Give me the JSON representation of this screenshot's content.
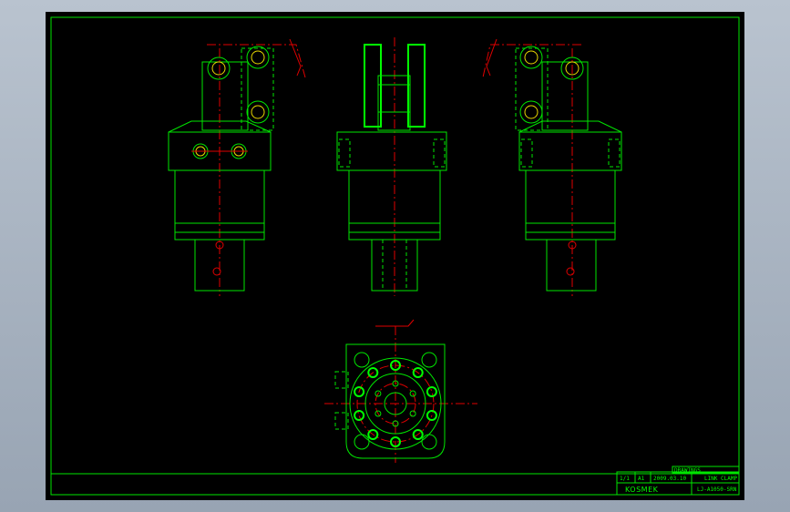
{
  "title_block": {
    "company": "KOSMEK",
    "customer_ref": "DRAWINGS",
    "date": "2009.03.10",
    "scale": "1/1",
    "size": "A1",
    "part_name": "LINK CLAMP",
    "model_no": "LJ-A1050-SRN"
  },
  "colors": {
    "background": "#000000",
    "outline": "#00e600",
    "centerline": "#e00000",
    "highlight": "#e8d900"
  }
}
